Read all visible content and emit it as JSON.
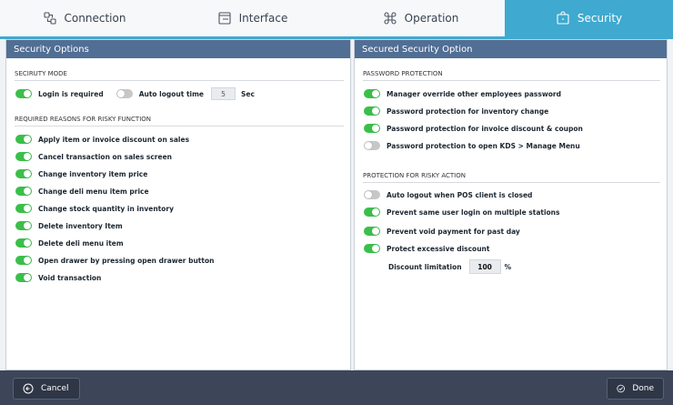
{
  "tabs": [
    {
      "label": "Connection",
      "icon": "connection-icon",
      "active": false
    },
    {
      "label": "Interface",
      "icon": "interface-icon",
      "active": false
    },
    {
      "label": "Operation",
      "icon": "command-icon",
      "active": false
    },
    {
      "label": "Security",
      "icon": "security-icon",
      "active": true
    }
  ],
  "left": {
    "title": "Security Options",
    "security_mode": {
      "heading": "SECIRUTY MODE",
      "login_required": {
        "label": "Login is required",
        "on": true
      },
      "auto_logout": {
        "label": "Auto logout time",
        "on": false,
        "value": "5",
        "unit": "Sec"
      }
    },
    "required_reasons": {
      "heading": "REQUIRED REASONS FOR RISKY FUNCTION",
      "items": [
        {
          "label": "Apply item or invoice discount on sales",
          "on": true
        },
        {
          "label": "Cancel transaction on sales screen",
          "on": true
        },
        {
          "label": "Change inventory item price",
          "on": true
        },
        {
          "label": "Change deli menu item price",
          "on": true
        },
        {
          "label": "Change stock quantity in inventory",
          "on": true
        },
        {
          "label": "Delete inventory Item",
          "on": true
        },
        {
          "label": "Delete deli menu item",
          "on": true
        },
        {
          "label": "Open drawer by pressing open drawer button",
          "on": true
        },
        {
          "label": "Void transaction",
          "on": true
        }
      ]
    }
  },
  "right": {
    "title": "Secured Security Option",
    "password_protection": {
      "heading": "PASSWORD PROTECTION",
      "items": [
        {
          "label": "Manager override other employees password",
          "on": true
        },
        {
          "label": "Password protection for inventory change",
          "on": true
        },
        {
          "label": "Password protection for invoice discount & coupon",
          "on": true
        },
        {
          "label": "Password protection to open KDS > Manage Menu",
          "on": false
        }
      ]
    },
    "risky_action": {
      "heading": "PROTECTION FOR RISKY ACTION",
      "items": [
        {
          "label": "Auto logout when POS client is closed",
          "on": false
        },
        {
          "label": "Prevent same user login on multiple stations",
          "on": true
        },
        {
          "label": "Prevent void payment for past day",
          "on": true
        },
        {
          "label": "Protect excessive discount",
          "on": true
        }
      ],
      "discount_limitation": {
        "label": "Discount limitation",
        "value": "100",
        "unit": "%"
      }
    }
  },
  "footer": {
    "cancel_label": "Cancel",
    "done_label": "Done"
  }
}
